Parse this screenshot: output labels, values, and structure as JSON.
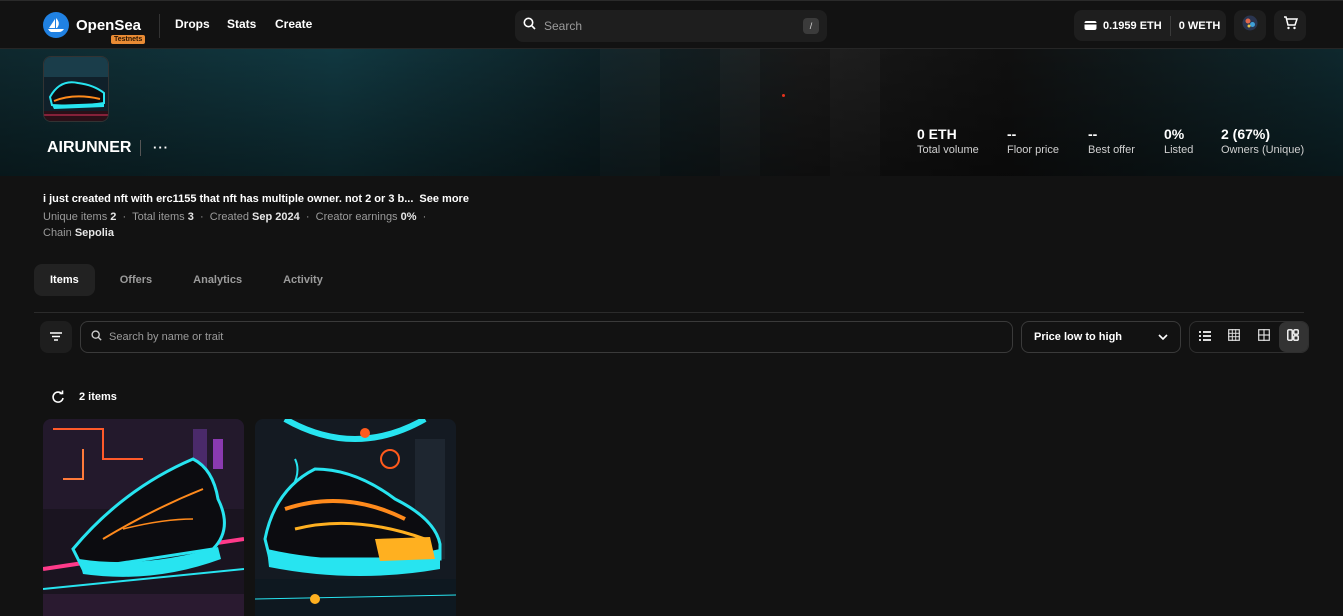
{
  "nav": {
    "brand": "OpenSea",
    "badge": "Testnets",
    "links": [
      "Drops",
      "Stats",
      "Create"
    ],
    "search_placeholder": "Search",
    "search_shortcut": "/",
    "eth_balance": "0.1959 ETH",
    "weth_balance": "0 WETH",
    "icons": [
      "opensea-logo-icon",
      "search-icon",
      "wallet-icon",
      "profile-icon",
      "cart-icon"
    ]
  },
  "collection": {
    "name": "AIRUNNER",
    "more": "···",
    "stats": [
      {
        "value": "0 ETH",
        "label": "Total volume"
      },
      {
        "value": "--",
        "label": "Floor price"
      },
      {
        "value": "--",
        "label": "Best offer"
      },
      {
        "value": "0%",
        "label": "Listed"
      },
      {
        "value": "2 (67%)",
        "label": "Owners (Unique)"
      }
    ],
    "description": "i just created nft with erc1155 that nft has multiple owner. not 2 or 3 b...",
    "see_more": "See more",
    "meta": {
      "unique_label": "Unique items",
      "unique_value": "2",
      "total_label": "Total items",
      "total_value": "3",
      "created_label": "Created",
      "created_value": "Sep 2024",
      "earnings_label": "Creator earnings",
      "earnings_value": "0%",
      "chain_label": "Chain",
      "chain_value": "Sepolia",
      "separator": "·"
    }
  },
  "tabs": [
    "Items",
    "Offers",
    "Analytics",
    "Activity"
  ],
  "active_tab": "Items",
  "toolbar": {
    "search_placeholder": "Search by name or trait",
    "sort_selected": "Price low to high",
    "views": [
      "list-view-icon",
      "small-grid-icon",
      "large-grid-icon",
      "mosaic-view-icon"
    ],
    "active_view": "mosaic-view-icon"
  },
  "items": {
    "count_label": "2 items"
  },
  "colors": {
    "accent": "#2081e2",
    "badge": "#e98b34",
    "background": "#121212",
    "neon_cyan": "#27e4f0",
    "neon_orange": "#ff8a1c"
  }
}
